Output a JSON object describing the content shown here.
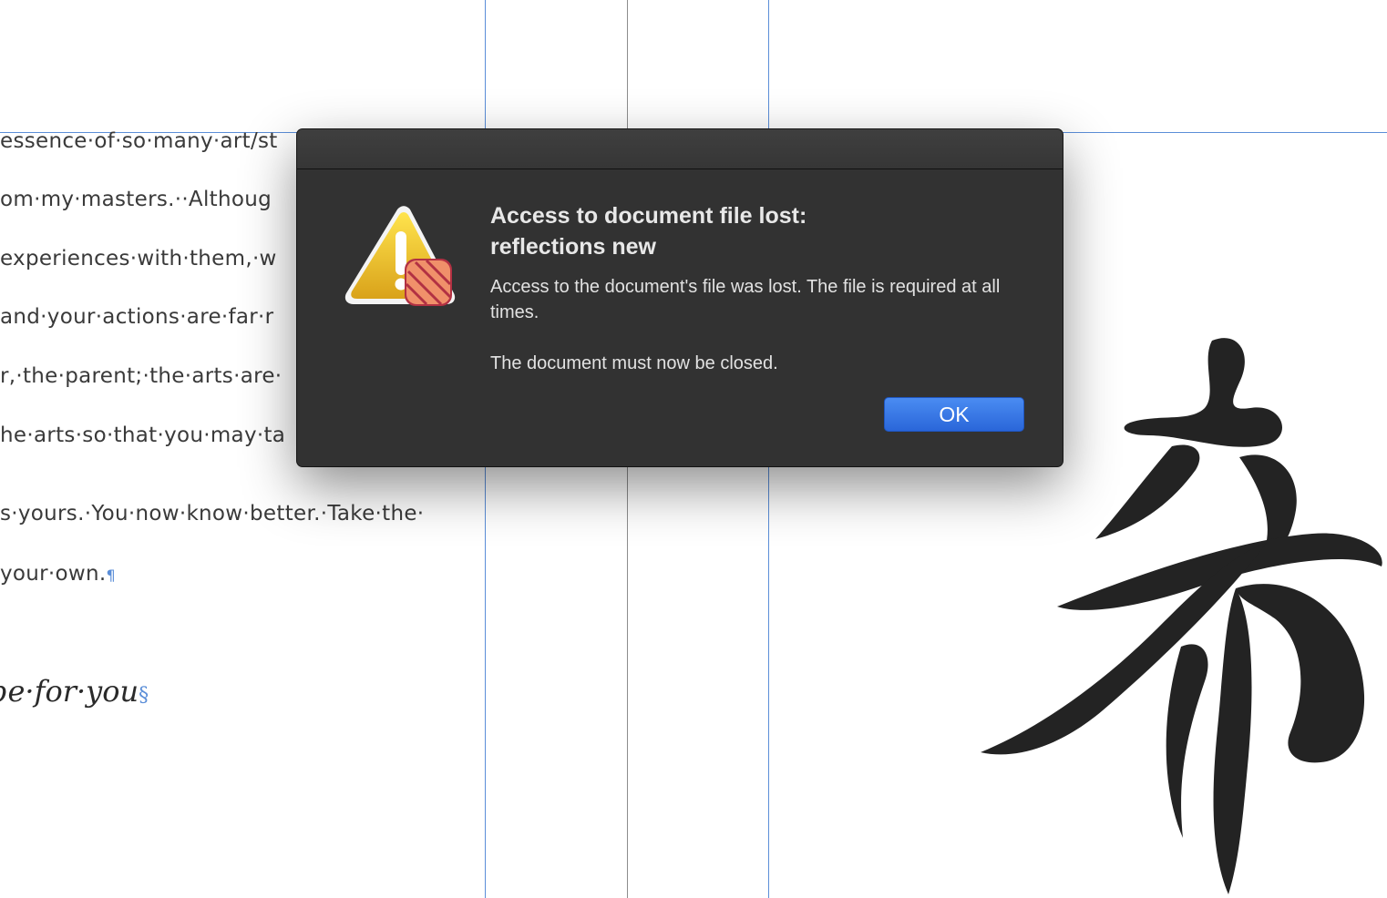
{
  "document": {
    "lines": [
      "essence·of·so·many·art/st",
      "om·my·masters.··Althoug",
      "experiences·with·them,·w",
      "and·your·actions·are·far·r",
      "r,·the·parent;·the·arts·are·",
      "he·arts·so·that·you·may·ta",
      "s·yours.·You·now·know·better.·Take·the·",
      "your·own."
    ],
    "pilcrow": "¶",
    "italic_line": "be·for·you",
    "section_mark": "§"
  },
  "dialog": {
    "title_line1": "Access to document file lost:",
    "title_line2": "reflections new",
    "message": "Access to the document's file was lost. The file is required at all times.",
    "message2": "The document must now be closed.",
    "ok_label": "OK",
    "icon": "warning-icon"
  },
  "colors": {
    "dialog_bg": "#323232",
    "button_blue": "#2a66d9",
    "guide_blue": "#5b8ed8"
  }
}
